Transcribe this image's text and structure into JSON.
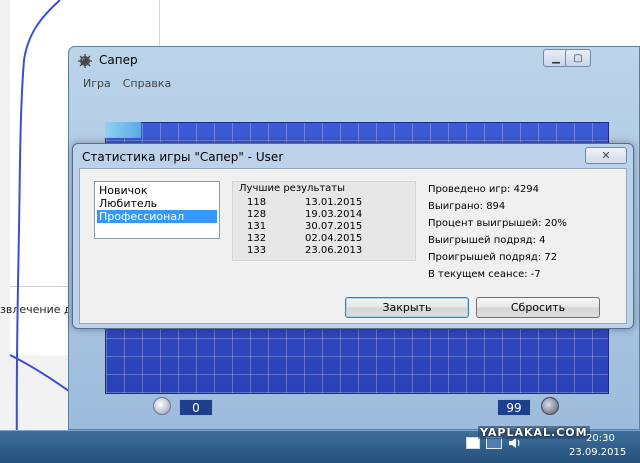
{
  "background": {
    "partial_text": "звлечение д"
  },
  "game_window": {
    "title": "Сапер",
    "menu": [
      "Игра",
      "Справка"
    ],
    "timer_value": "0",
    "mines_value": "99",
    "board_color": "#3048c8"
  },
  "dialog": {
    "title": "Статистика игры \"Сапер\" - User",
    "close_x": "✕",
    "levels": [
      {
        "label": "Новичок",
        "selected": false
      },
      {
        "label": "Любитель",
        "selected": false
      },
      {
        "label": "Профессионал",
        "selected": true
      }
    ],
    "best_title": "Лучшие результаты",
    "best_results": [
      {
        "score": "118",
        "date": "13.01.2015"
      },
      {
        "score": "128",
        "date": "19.03.2014"
      },
      {
        "score": "131",
        "date": "30.07.2015"
      },
      {
        "score": "132",
        "date": "02.04.2015"
      },
      {
        "score": "133",
        "date": "23.06.2013"
      }
    ],
    "stats": [
      "Проведено игр: 4294",
      "Выиграно: 894",
      "Процент выигрышей: 20%",
      "Выигрышей подряд: 4",
      "Проигрышей подряд: 72",
      "В текущем сеансе: -7"
    ],
    "close_button": "Закрыть",
    "reset_button": "Сбросить"
  },
  "taskbar": {
    "watermark": "YAPLAKAL.COM",
    "time": "20:30",
    "date": "23.09.2015"
  }
}
